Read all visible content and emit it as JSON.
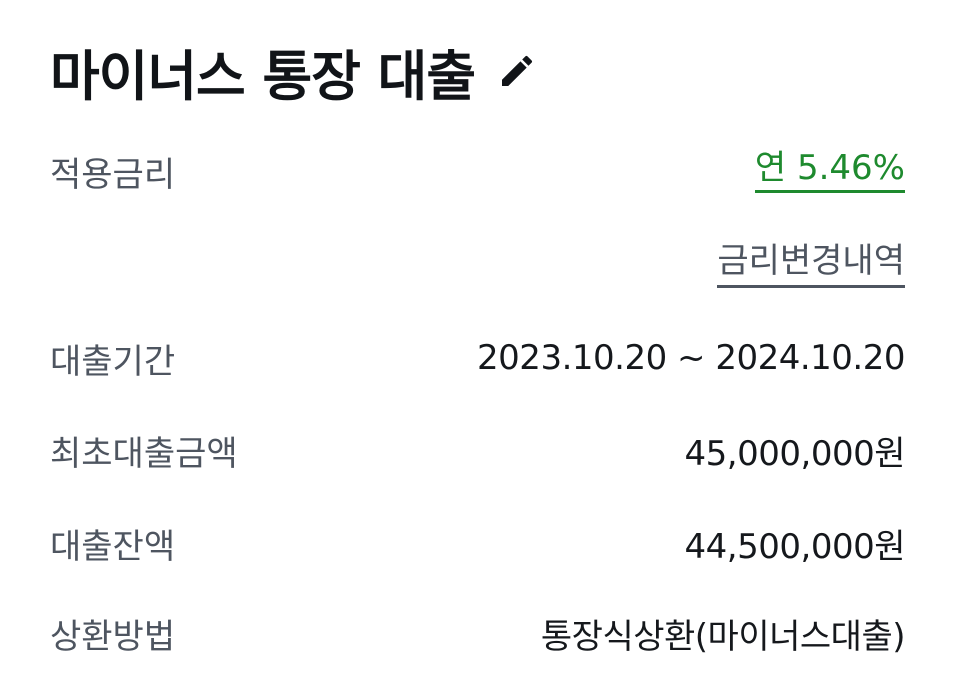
{
  "header": {
    "title": "마이너스 통장 대출",
    "edit_icon": "pencil-icon"
  },
  "rows": {
    "rate": {
      "label": "적용금리",
      "value": "연 5.46%"
    },
    "rate_history": {
      "link": "금리변경내역"
    },
    "period": {
      "label": "대출기간",
      "value": "2023.10.20 ~ 2024.10.20"
    },
    "initial_amount": {
      "label": "최초대출금액",
      "value": "45,000,000원"
    },
    "balance": {
      "label": "대출잔액",
      "value": "44,500,000원"
    },
    "repayment": {
      "label": "상환방법",
      "value": "통장식상환(마이너스대출)"
    }
  },
  "colors": {
    "rate_accent": "#1e8a2e",
    "label_gray": "#4e5560",
    "text_dark": "#15181c"
  }
}
